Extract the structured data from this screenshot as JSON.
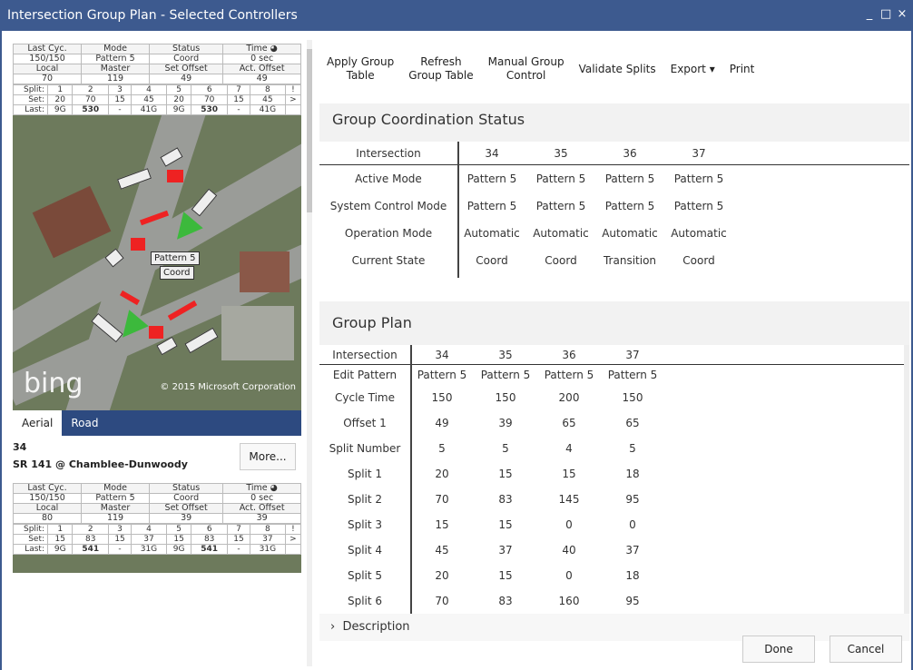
{
  "window": {
    "title": "Intersection Group Plan - Selected Controllers",
    "controls": [
      "_",
      "□",
      "×"
    ]
  },
  "controller1": {
    "header": [
      "Last Cyc.",
      "Mode",
      "Status",
      "Time"
    ],
    "values": [
      "150/150",
      "Pattern 5",
      "Coord",
      "0 sec"
    ],
    "header2": [
      "Local",
      "Master",
      "Set Offset",
      "Act. Offset"
    ],
    "values2": [
      "70",
      "119",
      "49",
      "49"
    ],
    "split": [
      "Split:",
      "1",
      "2",
      "3",
      "4",
      "5",
      "6",
      "7",
      "8",
      "!"
    ],
    "set": [
      "Set:",
      "20",
      "70",
      "15",
      "45",
      "20",
      "70",
      "15",
      "45",
      ">"
    ],
    "last": [
      "Last:",
      "9G",
      "530",
      "-",
      "41G",
      "9G",
      "530",
      "-",
      "41G",
      ""
    ]
  },
  "map": {
    "badge": "Pattern 5",
    "badge2": "Coord",
    "bing": "bing",
    "copyright": "© 2015 Microsoft Corporation",
    "tabs": [
      "Aerial",
      "Road"
    ]
  },
  "controller2": {
    "id": "34",
    "name": "SR 141 @ Chamblee-Dunwoody",
    "more": "More...",
    "header": [
      "Last Cyc.",
      "Mode",
      "Status",
      "Time"
    ],
    "values": [
      "150/150",
      "Pattern 5",
      "Coord",
      "0 sec"
    ],
    "header2": [
      "Local",
      "Master",
      "Set Offset",
      "Act. Offset"
    ],
    "values2": [
      "80",
      "119",
      "39",
      "39"
    ],
    "split": [
      "Split:",
      "1",
      "2",
      "3",
      "4",
      "5",
      "6",
      "7",
      "8",
      "!"
    ],
    "set": [
      "Set:",
      "15",
      "83",
      "15",
      "37",
      "15",
      "83",
      "15",
      "37",
      ">"
    ],
    "last": [
      "Last:",
      "9G",
      "541",
      "-",
      "31G",
      "9G",
      "541",
      "-",
      "31G",
      ""
    ]
  },
  "toolbar": {
    "apply_group_table": [
      "Apply Group",
      "Table"
    ],
    "refresh_group_table": [
      "Refresh",
      "Group Table"
    ],
    "manual_group_control": [
      "Manual Group",
      "Control"
    ],
    "validate_splits": "Validate Splits",
    "export": "Export",
    "print": "Print"
  },
  "gcs": {
    "title": "Group Coordination Status",
    "rows": [
      {
        "label": "Intersection",
        "vals": [
          "34",
          "35",
          "36",
          "37"
        ]
      },
      {
        "label": "Active Mode",
        "vals": [
          "Pattern 5",
          "Pattern 5",
          "Pattern 5",
          "Pattern 5"
        ]
      },
      {
        "label": "System Control Mode",
        "vals": [
          "Pattern 5",
          "Pattern 5",
          "Pattern 5",
          "Pattern 5"
        ]
      },
      {
        "label": "Operation Mode",
        "vals": [
          "Automatic",
          "Automatic",
          "Automatic",
          "Automatic"
        ]
      },
      {
        "label": "Current State",
        "vals": [
          "Coord",
          "Coord",
          "Transition",
          "Coord"
        ]
      }
    ]
  },
  "gp": {
    "title": "Group Plan",
    "rows": [
      {
        "label": "Intersection",
        "vals": [
          "34",
          "35",
          "36",
          "37"
        ]
      },
      {
        "label": "Edit Pattern",
        "vals": [
          "Pattern 5",
          "Pattern 5",
          "Pattern 5",
          "Pattern 5"
        ]
      },
      {
        "label": "Cycle Time",
        "vals": [
          "150",
          "150",
          "200",
          "150"
        ]
      },
      {
        "label": "Offset 1",
        "vals": [
          "49",
          "39",
          "65",
          "65"
        ]
      },
      {
        "label": "Split Number",
        "vals": [
          "5",
          "5",
          "4",
          "5"
        ]
      },
      {
        "label": "Split 1",
        "vals": [
          "20",
          "15",
          "15",
          "18"
        ]
      },
      {
        "label": "Split 2",
        "vals": [
          "70",
          "83",
          "145",
          "95"
        ]
      },
      {
        "label": "Split 3",
        "vals": [
          "15",
          "15",
          "0",
          "0"
        ]
      },
      {
        "label": "Split 4",
        "vals": [
          "45",
          "37",
          "40",
          "37"
        ]
      },
      {
        "label": "Split 5",
        "vals": [
          "20",
          "15",
          "0",
          "18"
        ]
      },
      {
        "label": "Split 6",
        "vals": [
          "70",
          "83",
          "160",
          "95"
        ]
      }
    ]
  },
  "description": "Description",
  "buttons": {
    "done": "Done",
    "cancel": "Cancel"
  }
}
